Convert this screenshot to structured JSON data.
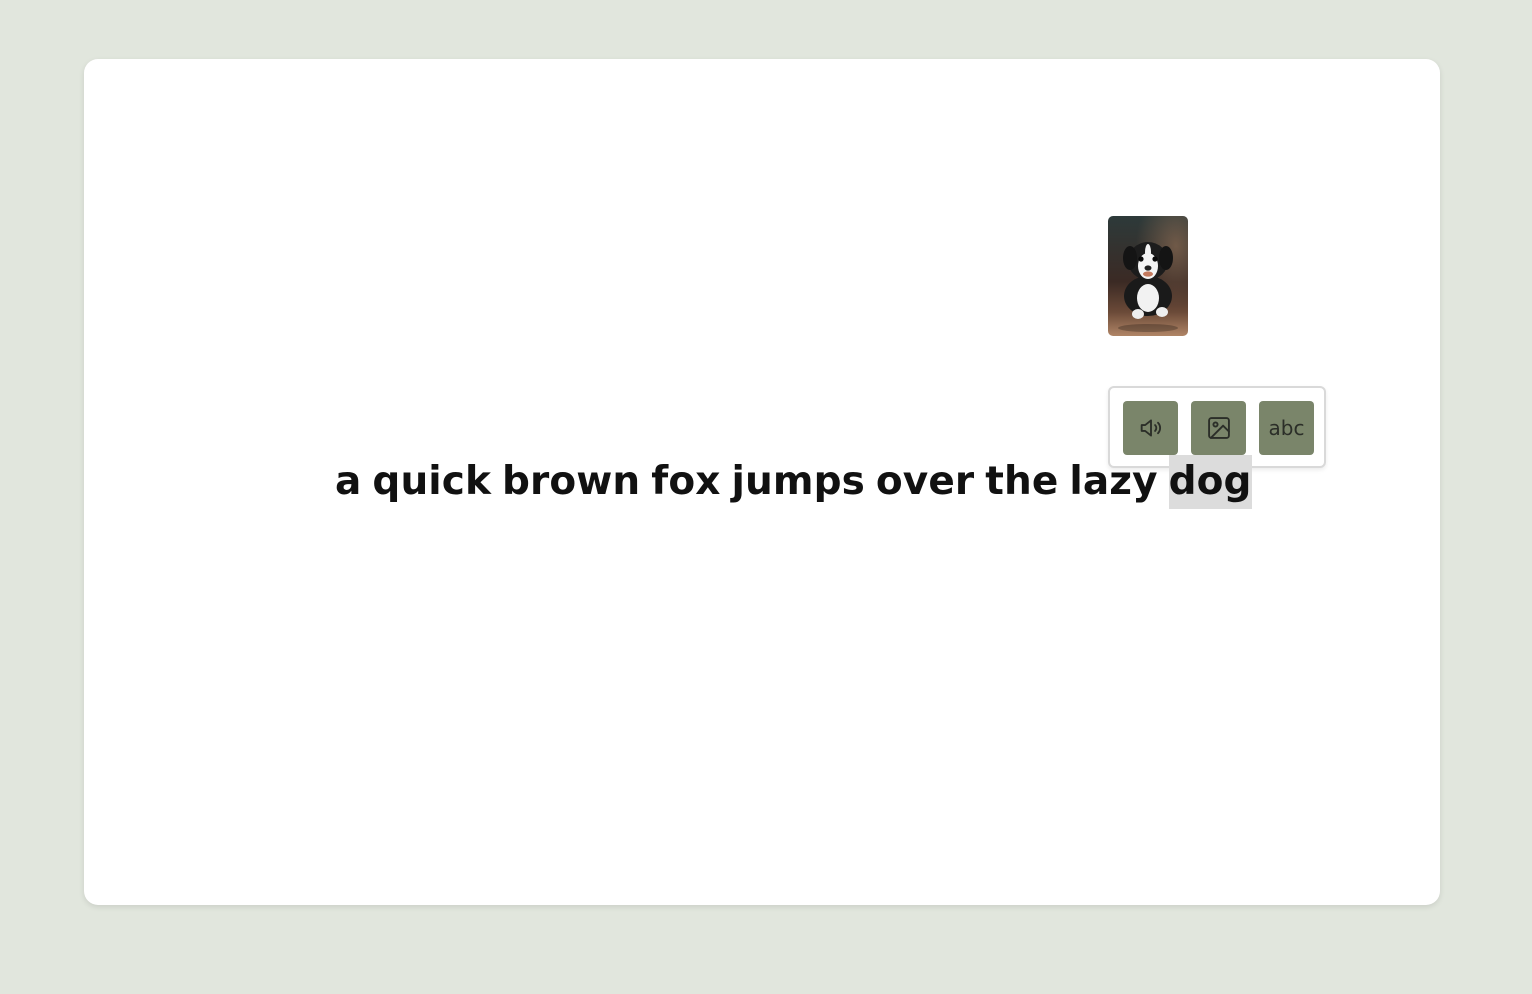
{
  "sentence": {
    "words": [
      "a",
      "quick",
      "brown",
      "fox",
      "jumps",
      "over",
      "the",
      "lazy",
      "dog"
    ],
    "selected_word": "dog"
  },
  "toolbar": {
    "audio_icon": "speaker-icon",
    "image_icon": "image-icon",
    "text_label": "abc"
  },
  "colors": {
    "background": "#e1e6dd",
    "card": "#ffffff",
    "button": "#7a856a",
    "selection": "#dcdcdc",
    "text": "#111111"
  }
}
